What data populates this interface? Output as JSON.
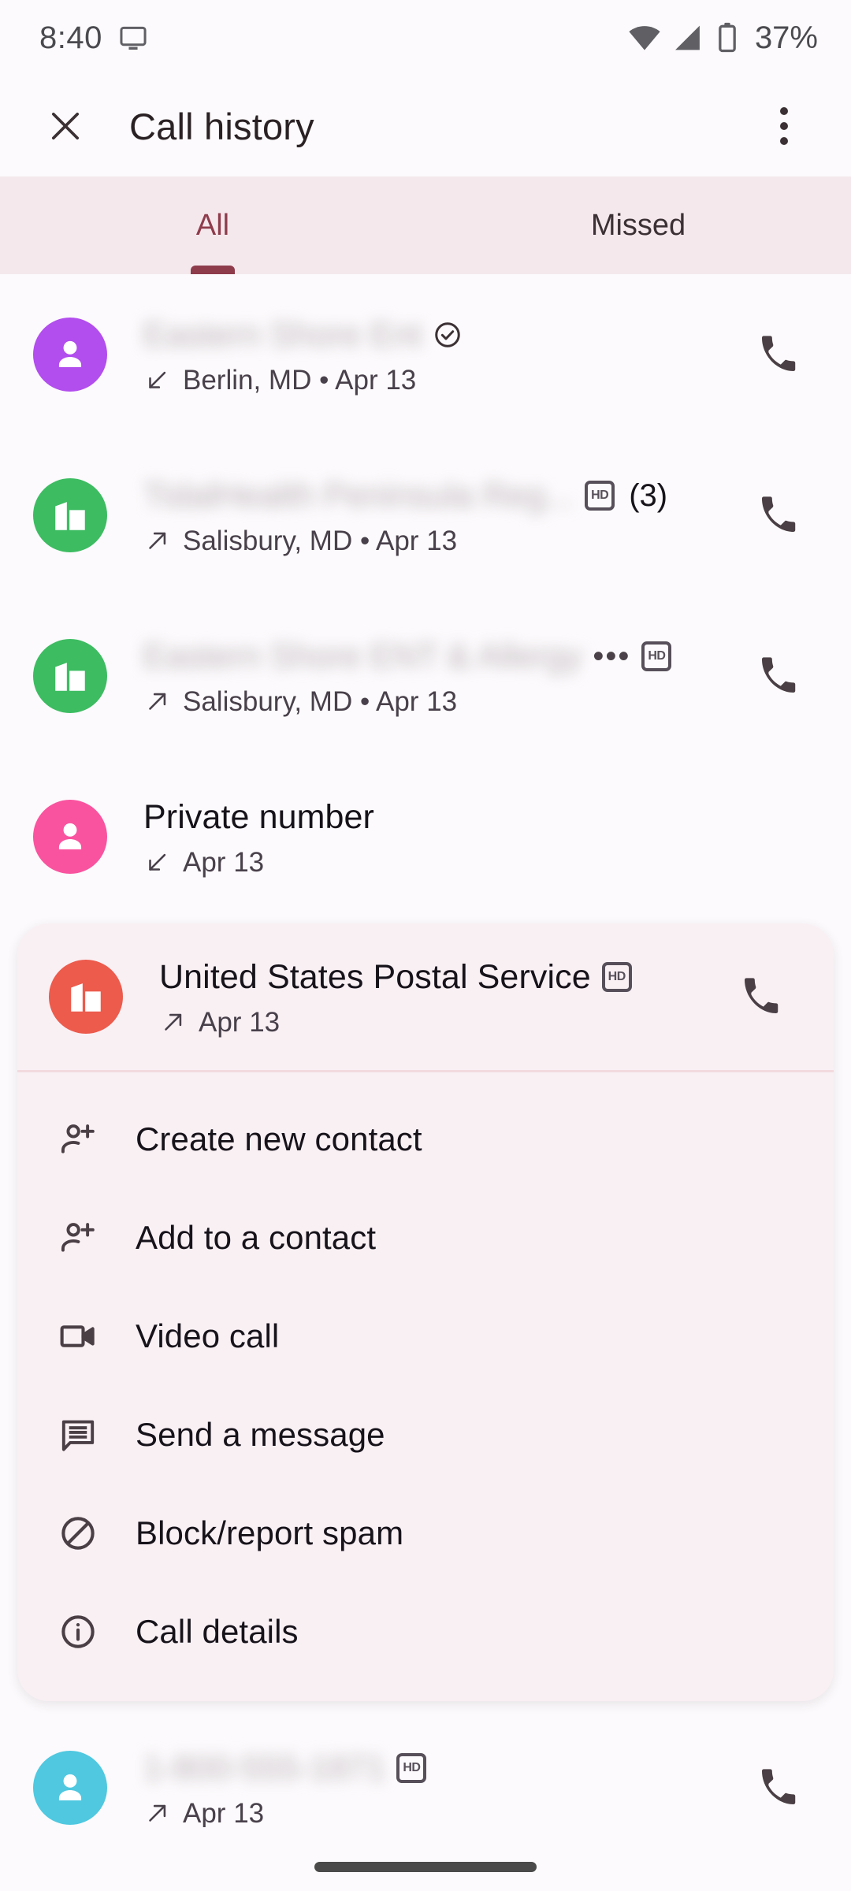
{
  "status_bar": {
    "time": "8:40",
    "cast_icon": "cast-screen-icon",
    "wifi_icon": "wifi-icon",
    "signal_icon": "cellular-signal-icon",
    "battery_icon": "battery-icon",
    "battery_text": "37%"
  },
  "app_bar": {
    "close_icon": "close-icon",
    "title": "Call history",
    "overflow_icon": "more-vert-icon"
  },
  "tabs": {
    "items": [
      {
        "label": "All",
        "active": true
      },
      {
        "label": "Missed",
        "active": false
      }
    ],
    "active_color": "#8E3C4C",
    "background": "#F5E8ED"
  },
  "calls": [
    {
      "name": "",
      "blurred": true,
      "avatar_type": "person",
      "avatar_color": "#B24DEE",
      "verified": true,
      "hd": false,
      "count": "",
      "ellipsis": false,
      "direction_icon": "incoming-call-arrow",
      "subtitle": "Berlin, MD • Apr 13",
      "call_icon": "phone-icon"
    },
    {
      "name": "",
      "blurred": true,
      "avatar_type": "business",
      "avatar_color": "#3DBC62",
      "verified": false,
      "hd": true,
      "count": "(3)",
      "ellipsis": false,
      "direction_icon": "outgoing-call-arrow",
      "subtitle": "Salisbury, MD • Apr 13",
      "call_icon": "phone-icon"
    },
    {
      "name": "",
      "blurred": true,
      "avatar_type": "business",
      "avatar_color": "#3DBC62",
      "verified": false,
      "hd": true,
      "count": "",
      "ellipsis": true,
      "direction_icon": "outgoing-call-arrow",
      "subtitle": "Salisbury, MD • Apr 13",
      "call_icon": "phone-icon"
    },
    {
      "name": "Private number",
      "blurred": false,
      "avatar_type": "person",
      "avatar_color": "#F9539F",
      "verified": false,
      "hd": false,
      "count": "",
      "ellipsis": false,
      "direction_icon": "incoming-call-arrow",
      "subtitle": "Apr 13",
      "call_icon": "phone-icon"
    }
  ],
  "selected_call": {
    "name": "United States Postal Service",
    "blurred": false,
    "avatar_type": "business",
    "avatar_color": "#EC5B4C",
    "hd": true,
    "direction_icon": "outgoing-call-arrow",
    "subtitle": "Apr 13",
    "call_icon": "phone-icon",
    "card_background": "#F9F0F4"
  },
  "context_menu": {
    "items": [
      {
        "label": "Create new contact",
        "icon": "person-add-icon"
      },
      {
        "label": "Add to a contact",
        "icon": "person-add-icon"
      },
      {
        "label": "Video call",
        "icon": "video-camera-icon"
      },
      {
        "label": "Send a message",
        "icon": "message-bubble-icon"
      },
      {
        "label": "Block/report spam",
        "icon": "block-icon"
      },
      {
        "label": "Call details",
        "icon": "info-icon"
      }
    ]
  },
  "trailing_call": {
    "name": "",
    "blurred": true,
    "avatar_type": "person",
    "avatar_color": "#4FC8E0",
    "hd": true,
    "direction_icon": "outgoing-call-arrow",
    "subtitle": "Apr 13",
    "call_icon": "phone-icon"
  },
  "nav_bar": {
    "pill": "home-gesture-pill"
  }
}
